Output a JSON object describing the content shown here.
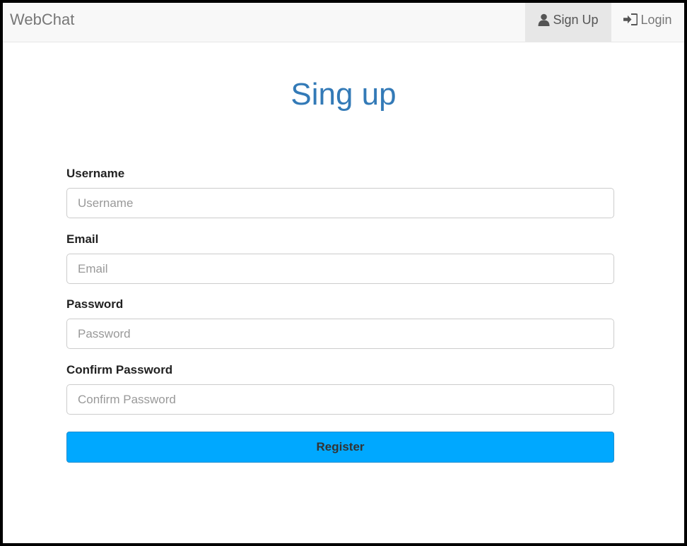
{
  "navbar": {
    "brand": "WebChat",
    "items": [
      {
        "label": "Sign Up",
        "icon": "user-icon",
        "active": true
      },
      {
        "label": "Login",
        "icon": "login-icon",
        "active": false
      }
    ]
  },
  "page": {
    "title": "Sing up"
  },
  "form": {
    "fields": [
      {
        "label": "Username",
        "placeholder": "Username",
        "value": ""
      },
      {
        "label": "Email",
        "placeholder": "Email",
        "value": ""
      },
      {
        "label": "Password",
        "placeholder": "Password",
        "value": ""
      },
      {
        "label": "Confirm Password",
        "placeholder": "Confirm Password",
        "value": ""
      }
    ],
    "submit_label": "Register"
  },
  "colors": {
    "title": "#337ab7",
    "button": "#00a8ff",
    "navbar_bg": "#f8f8f8",
    "active_nav_bg": "#e7e7e7"
  }
}
